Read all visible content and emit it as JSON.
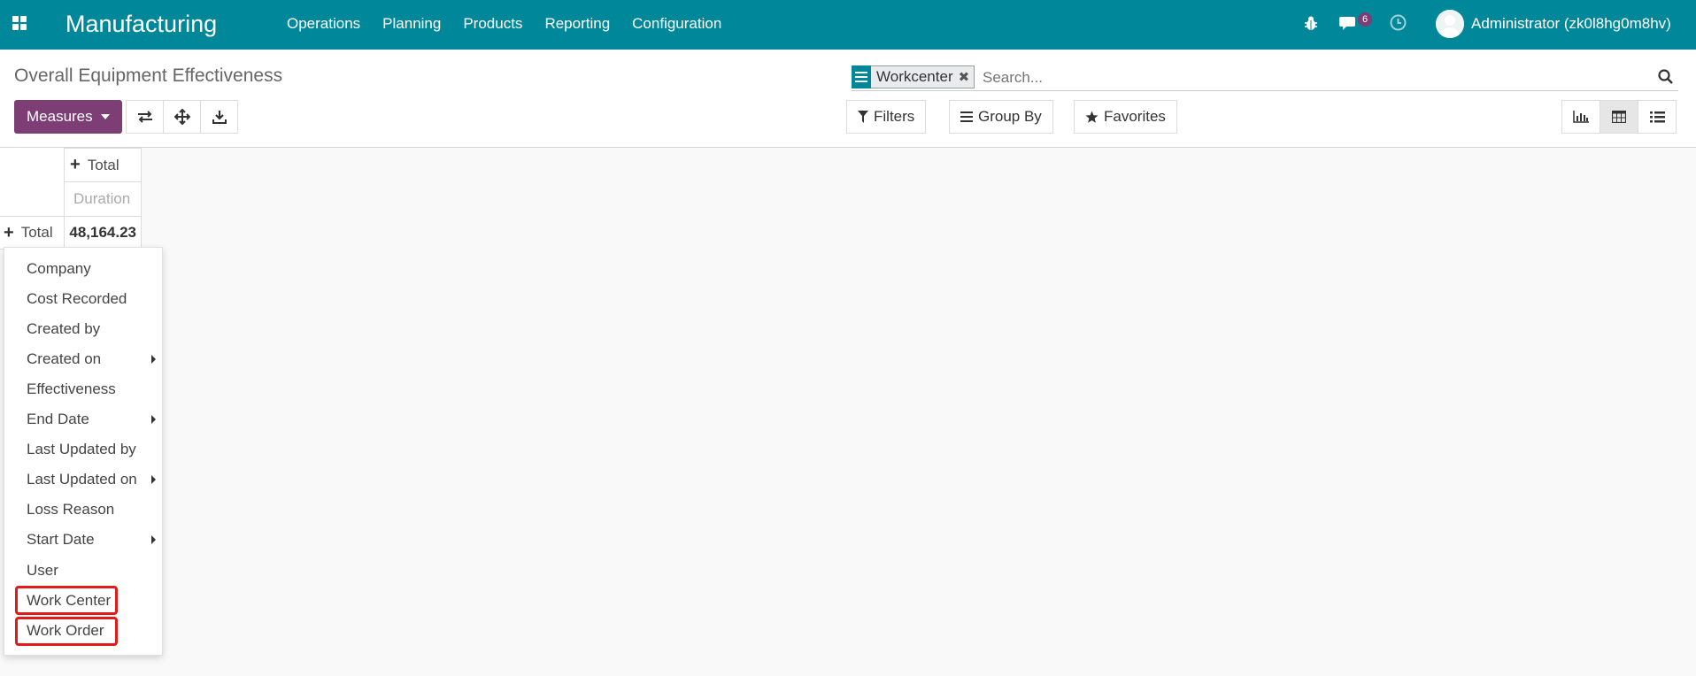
{
  "navbar": {
    "app_name": "Manufacturing",
    "menu": [
      "Operations",
      "Planning",
      "Products",
      "Reporting",
      "Configuration"
    ],
    "message_count": "6",
    "user": "Administrator (zk0l8hg0m8hv)",
    "icons": [
      "apps-icon",
      "bug-icon",
      "chat-icon",
      "clock-icon",
      "avatar"
    ]
  },
  "control_panel": {
    "title": "Overall Equipment Effectiveness",
    "facet": "Workcenter",
    "search_placeholder": "Search...",
    "measures_label": "Measures",
    "filters_label": "Filters",
    "groupby_label": "Group By",
    "favorites_label": "Favorites"
  },
  "pivot": {
    "col_header": "Total",
    "measure_header": "Duration",
    "row_header": "Total",
    "total_value": "48,164.23"
  },
  "groupby_menu": {
    "items": [
      {
        "label": "Company",
        "submenu": false
      },
      {
        "label": "Cost Recorded",
        "submenu": false
      },
      {
        "label": "Created by",
        "submenu": false
      },
      {
        "label": "Created on",
        "submenu": true
      },
      {
        "label": "Effectiveness",
        "submenu": false
      },
      {
        "label": "End Date",
        "submenu": true
      },
      {
        "label": "Last Updated by",
        "submenu": false
      },
      {
        "label": "Last Updated on",
        "submenu": true
      },
      {
        "label": "Loss Reason",
        "submenu": false
      },
      {
        "label": "Start Date",
        "submenu": true
      },
      {
        "label": "User",
        "submenu": false
      },
      {
        "label": "Work Center",
        "submenu": false,
        "highlighted": true
      },
      {
        "label": "Work Order",
        "submenu": false,
        "highlighted": true
      }
    ]
  },
  "colors": {
    "navbar": "#00889a",
    "primary": "#7c3e74",
    "highlight": "#e01b1b"
  }
}
